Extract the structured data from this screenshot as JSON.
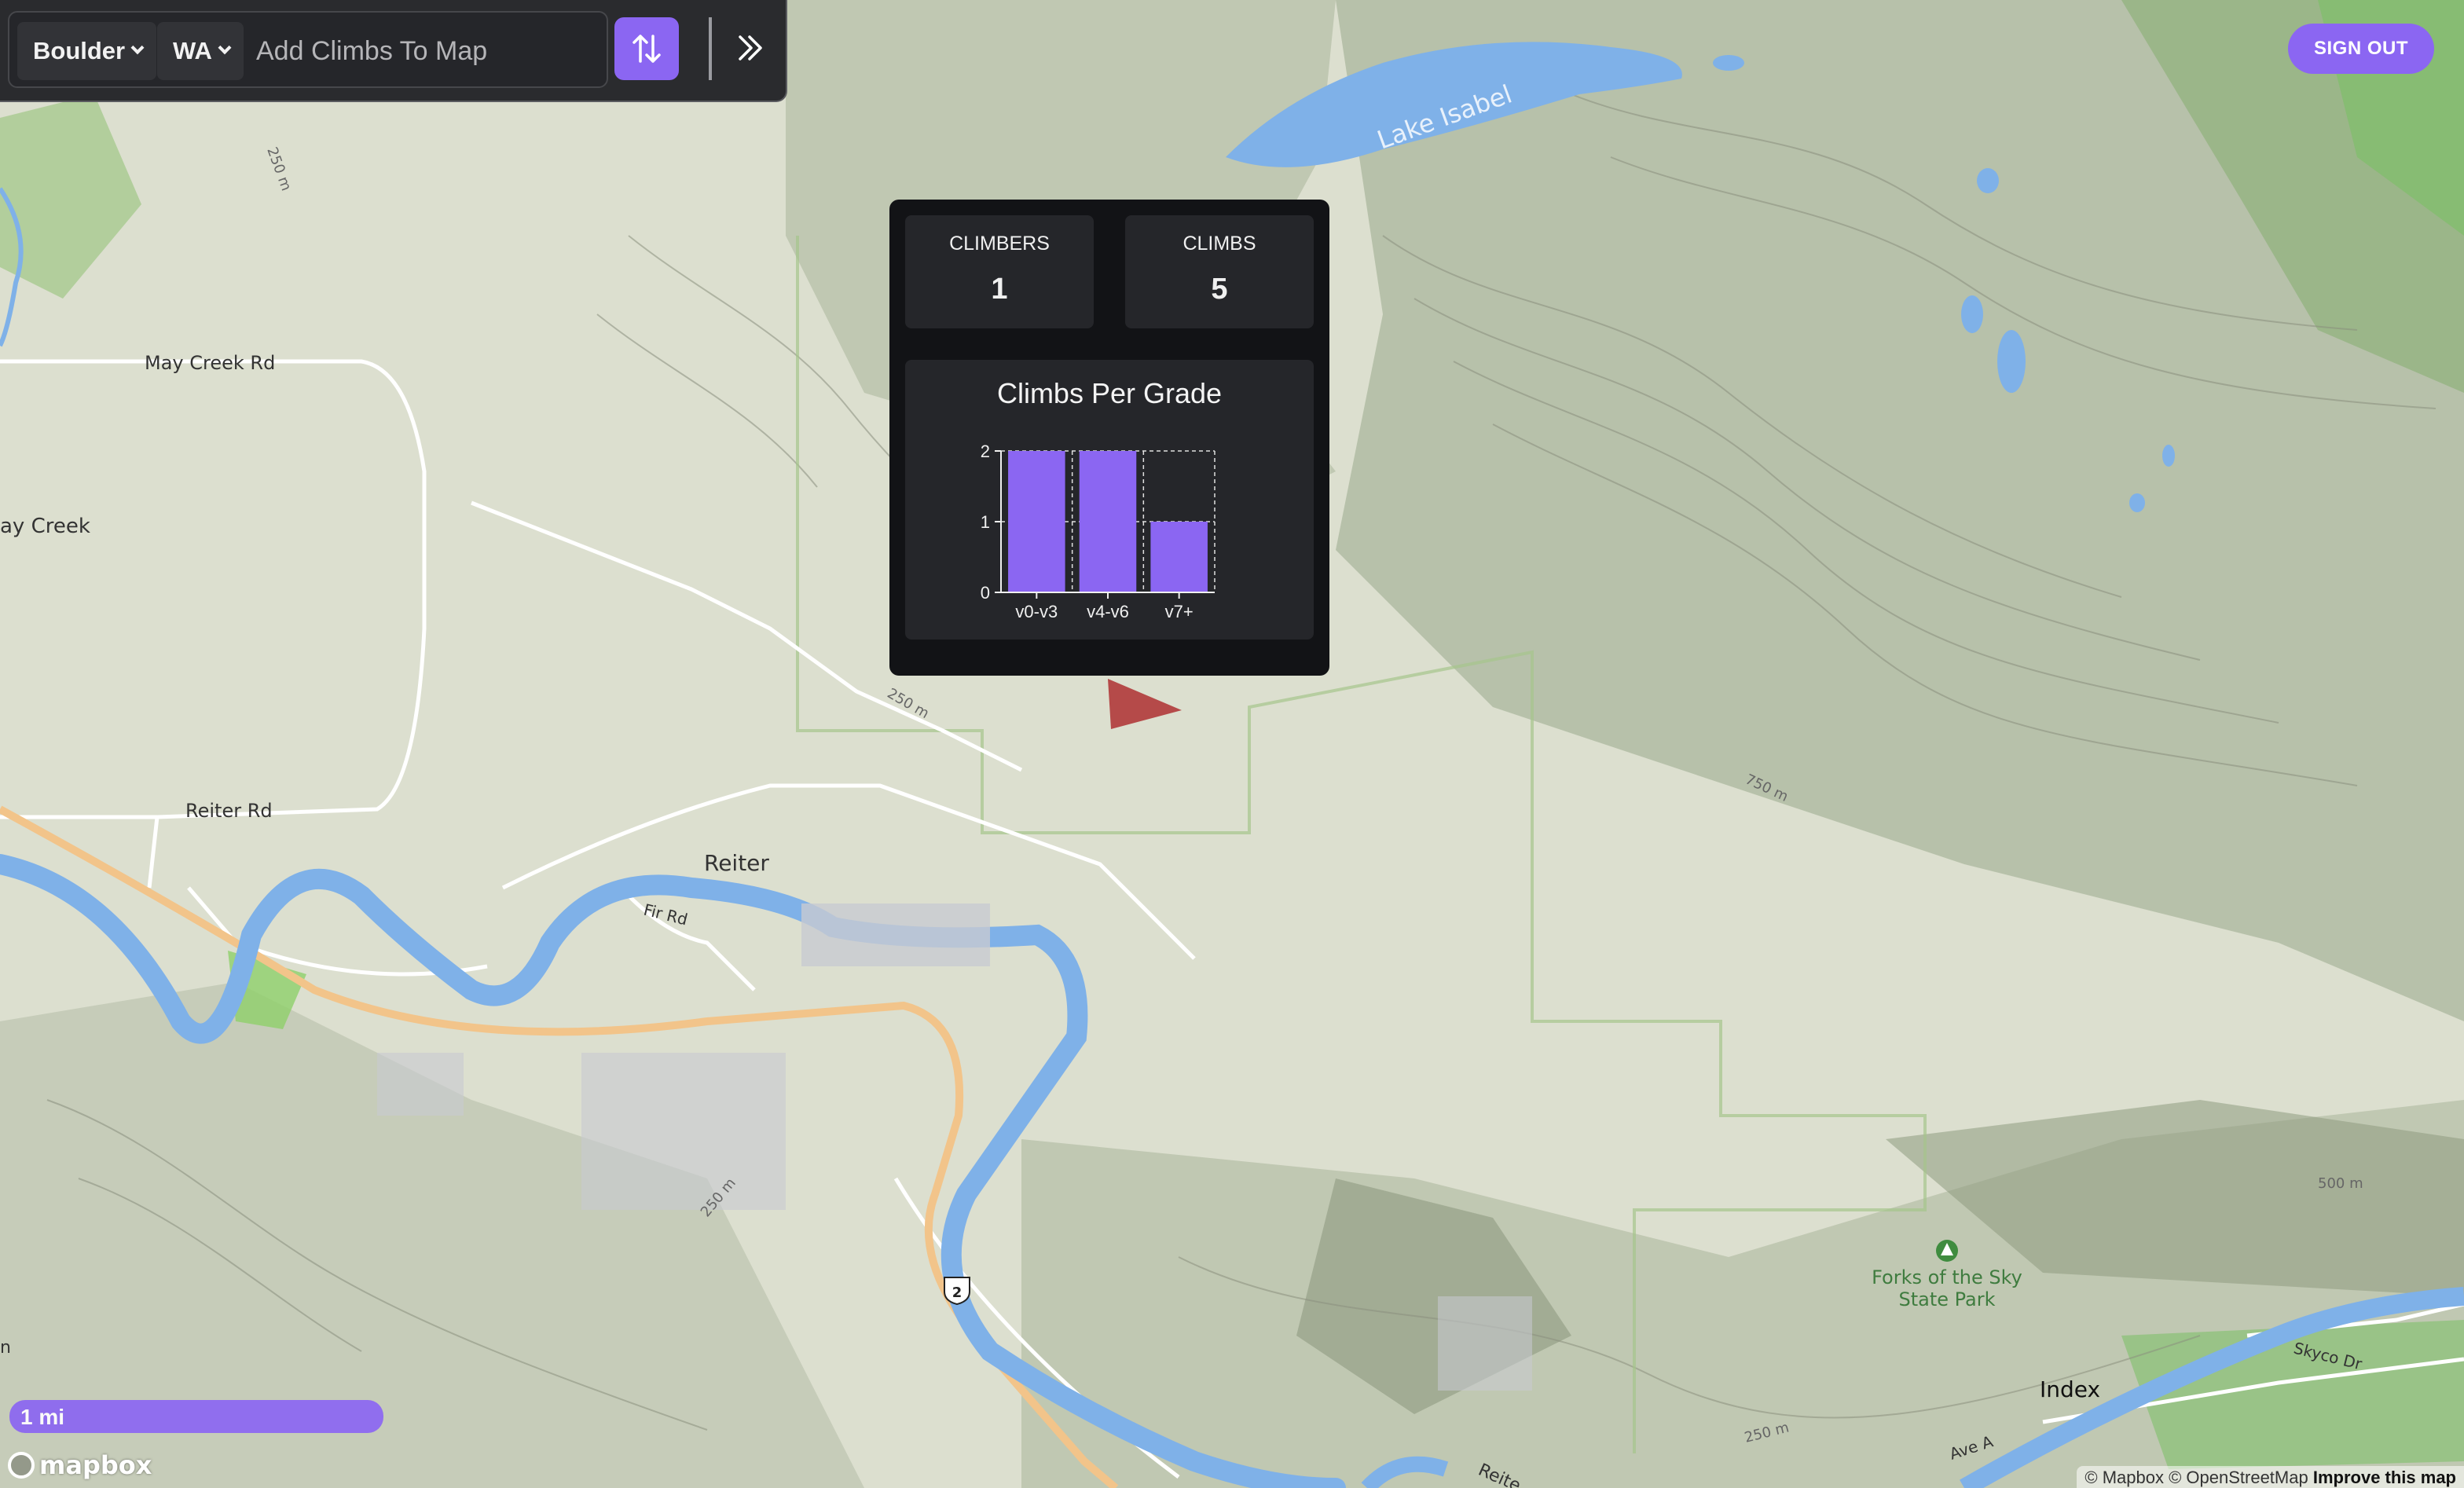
{
  "toolbar": {
    "climb_type": "Boulder",
    "region": "WA",
    "search_placeholder": "Add Climbs To Map"
  },
  "auth": {
    "sign_out_label": "SIGN OUT"
  },
  "popup": {
    "climbers_label": "CLIMBERS",
    "climbers_value": "1",
    "climbs_label": "CLIMBS",
    "climbs_value": "5",
    "chart_title": "Climbs Per Grade"
  },
  "chart_data": {
    "type": "bar",
    "title": "Climbs Per Grade",
    "categories": [
      "v0-v3",
      "v4-v6",
      "v7+"
    ],
    "values": [
      2,
      2,
      1
    ],
    "ylim": [
      0,
      2
    ],
    "yticks": [
      0,
      1,
      2
    ],
    "xlabel": "",
    "ylabel": "",
    "grid": true,
    "color": "#8b66f2"
  },
  "map": {
    "labels": {
      "lake": "Lake Isabel",
      "may_creek_rd": "May Creek Rd",
      "may_creek": "ay Creek",
      "reiter_rd": "Reiter Rd",
      "reiter": "Reiter",
      "fir_rd": "Fir Rd",
      "park_line1": "Forks of the Sky",
      "park_line2": "State Park",
      "index": "Index",
      "skyco": "Skyco Dr",
      "ave_a": "Ave A",
      "reiter_bottom": "Reite",
      "highway": "2",
      "c250_1": "250 m",
      "c250_2": "250 m",
      "c250_3": "250 m",
      "c250_4": "250 m",
      "c750": "750 m",
      "c500": "500 m",
      "left_edge": "n"
    },
    "scale": "1 mi",
    "logo": "mapbox",
    "attribution": "© Mapbox © OpenStreetMap",
    "improve_link": "Improve this map"
  },
  "colors": {
    "accent": "#8b66f2",
    "panel": "#25262a",
    "popup_bg": "#121316",
    "water": "#7fb1e8",
    "marker": "#b03a3a"
  }
}
